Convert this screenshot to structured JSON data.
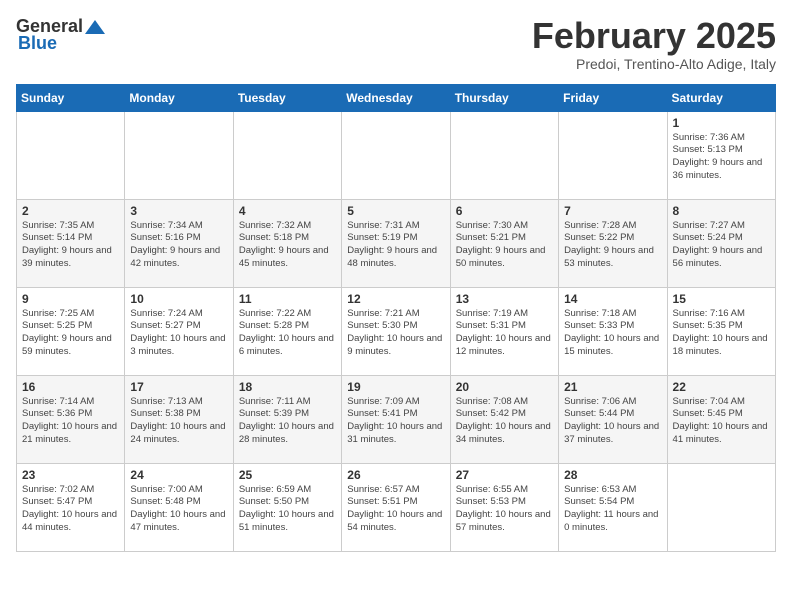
{
  "header": {
    "logo_general": "General",
    "logo_blue": "Blue",
    "month_title": "February 2025",
    "location": "Predoi, Trentino-Alto Adige, Italy"
  },
  "weekdays": [
    "Sunday",
    "Monday",
    "Tuesday",
    "Wednesday",
    "Thursday",
    "Friday",
    "Saturday"
  ],
  "weeks": [
    [
      {
        "day": "",
        "info": ""
      },
      {
        "day": "",
        "info": ""
      },
      {
        "day": "",
        "info": ""
      },
      {
        "day": "",
        "info": ""
      },
      {
        "day": "",
        "info": ""
      },
      {
        "day": "",
        "info": ""
      },
      {
        "day": "1",
        "info": "Sunrise: 7:36 AM\nSunset: 5:13 PM\nDaylight: 9 hours and 36 minutes."
      }
    ],
    [
      {
        "day": "2",
        "info": "Sunrise: 7:35 AM\nSunset: 5:14 PM\nDaylight: 9 hours and 39 minutes."
      },
      {
        "day": "3",
        "info": "Sunrise: 7:34 AM\nSunset: 5:16 PM\nDaylight: 9 hours and 42 minutes."
      },
      {
        "day": "4",
        "info": "Sunrise: 7:32 AM\nSunset: 5:18 PM\nDaylight: 9 hours and 45 minutes."
      },
      {
        "day": "5",
        "info": "Sunrise: 7:31 AM\nSunset: 5:19 PM\nDaylight: 9 hours and 48 minutes."
      },
      {
        "day": "6",
        "info": "Sunrise: 7:30 AM\nSunset: 5:21 PM\nDaylight: 9 hours and 50 minutes."
      },
      {
        "day": "7",
        "info": "Sunrise: 7:28 AM\nSunset: 5:22 PM\nDaylight: 9 hours and 53 minutes."
      },
      {
        "day": "8",
        "info": "Sunrise: 7:27 AM\nSunset: 5:24 PM\nDaylight: 9 hours and 56 minutes."
      }
    ],
    [
      {
        "day": "9",
        "info": "Sunrise: 7:25 AM\nSunset: 5:25 PM\nDaylight: 9 hours and 59 minutes."
      },
      {
        "day": "10",
        "info": "Sunrise: 7:24 AM\nSunset: 5:27 PM\nDaylight: 10 hours and 3 minutes."
      },
      {
        "day": "11",
        "info": "Sunrise: 7:22 AM\nSunset: 5:28 PM\nDaylight: 10 hours and 6 minutes."
      },
      {
        "day": "12",
        "info": "Sunrise: 7:21 AM\nSunset: 5:30 PM\nDaylight: 10 hours and 9 minutes."
      },
      {
        "day": "13",
        "info": "Sunrise: 7:19 AM\nSunset: 5:31 PM\nDaylight: 10 hours and 12 minutes."
      },
      {
        "day": "14",
        "info": "Sunrise: 7:18 AM\nSunset: 5:33 PM\nDaylight: 10 hours and 15 minutes."
      },
      {
        "day": "15",
        "info": "Sunrise: 7:16 AM\nSunset: 5:35 PM\nDaylight: 10 hours and 18 minutes."
      }
    ],
    [
      {
        "day": "16",
        "info": "Sunrise: 7:14 AM\nSunset: 5:36 PM\nDaylight: 10 hours and 21 minutes."
      },
      {
        "day": "17",
        "info": "Sunrise: 7:13 AM\nSunset: 5:38 PM\nDaylight: 10 hours and 24 minutes."
      },
      {
        "day": "18",
        "info": "Sunrise: 7:11 AM\nSunset: 5:39 PM\nDaylight: 10 hours and 28 minutes."
      },
      {
        "day": "19",
        "info": "Sunrise: 7:09 AM\nSunset: 5:41 PM\nDaylight: 10 hours and 31 minutes."
      },
      {
        "day": "20",
        "info": "Sunrise: 7:08 AM\nSunset: 5:42 PM\nDaylight: 10 hours and 34 minutes."
      },
      {
        "day": "21",
        "info": "Sunrise: 7:06 AM\nSunset: 5:44 PM\nDaylight: 10 hours and 37 minutes."
      },
      {
        "day": "22",
        "info": "Sunrise: 7:04 AM\nSunset: 5:45 PM\nDaylight: 10 hours and 41 minutes."
      }
    ],
    [
      {
        "day": "23",
        "info": "Sunrise: 7:02 AM\nSunset: 5:47 PM\nDaylight: 10 hours and 44 minutes."
      },
      {
        "day": "24",
        "info": "Sunrise: 7:00 AM\nSunset: 5:48 PM\nDaylight: 10 hours and 47 minutes."
      },
      {
        "day": "25",
        "info": "Sunrise: 6:59 AM\nSunset: 5:50 PM\nDaylight: 10 hours and 51 minutes."
      },
      {
        "day": "26",
        "info": "Sunrise: 6:57 AM\nSunset: 5:51 PM\nDaylight: 10 hours and 54 minutes."
      },
      {
        "day": "27",
        "info": "Sunrise: 6:55 AM\nSunset: 5:53 PM\nDaylight: 10 hours and 57 minutes."
      },
      {
        "day": "28",
        "info": "Sunrise: 6:53 AM\nSunset: 5:54 PM\nDaylight: 11 hours and 0 minutes."
      },
      {
        "day": "",
        "info": ""
      }
    ]
  ]
}
